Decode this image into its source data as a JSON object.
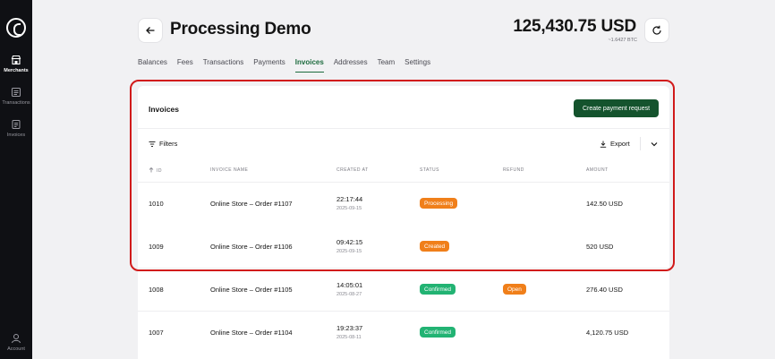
{
  "sidebar": {
    "items": [
      {
        "label": "Merchants",
        "icon": "store-icon",
        "active": true
      },
      {
        "label": "Transactions",
        "icon": "list-icon",
        "active": false
      },
      {
        "label": "Invoices",
        "icon": "invoice-icon",
        "active": false
      }
    ],
    "account_label": "Account"
  },
  "header": {
    "title": "Processing Demo",
    "balance": "125,430.75 USD",
    "balance_sub": "~1.6427 BTC"
  },
  "tabs": [
    {
      "label": "Balances",
      "active": false
    },
    {
      "label": "Fees",
      "active": false
    },
    {
      "label": "Transactions",
      "active": false
    },
    {
      "label": "Payments",
      "active": false
    },
    {
      "label": "Invoices",
      "active": true
    },
    {
      "label": "Addresses",
      "active": false
    },
    {
      "label": "Team",
      "active": false
    },
    {
      "label": "Settings",
      "active": false
    }
  ],
  "card": {
    "title": "Invoices",
    "create_label": "Create payment request",
    "filters_label": "Filters",
    "export_label": "Export"
  },
  "table": {
    "columns": [
      "ID",
      "Invoice name",
      "Created at",
      "Status",
      "Refund",
      "Amount"
    ],
    "rows": [
      {
        "id": "1010",
        "name": "Online Store – Order #1107",
        "time": "22:17:44",
        "date": "2025-09-15",
        "status": "Processing",
        "status_kind": "processing",
        "refund": "",
        "amount": "142.50 USD"
      },
      {
        "id": "1009",
        "name": "Online Store – Order #1106",
        "time": "09:42:15",
        "date": "2025-09-15",
        "status": "Created",
        "status_kind": "created",
        "refund": "",
        "amount": "520 USD"
      },
      {
        "id": "1008",
        "name": "Online Store – Order #1105",
        "time": "14:05:01",
        "date": "2025-08-27",
        "status": "Confirmed",
        "status_kind": "confirmed",
        "refund": "Open",
        "amount": "276.40 USD"
      },
      {
        "id": "1007",
        "name": "Online Store – Order #1104",
        "time": "19:23:37",
        "date": "2025-08-11",
        "status": "Confirmed",
        "status_kind": "confirmed",
        "refund": "",
        "amount": "4,120.75 USD"
      }
    ]
  },
  "colors": {
    "primary": "#14532d",
    "highlight": "#d11a1a",
    "processing": "#f07f1a",
    "confirmed": "#22b373"
  }
}
